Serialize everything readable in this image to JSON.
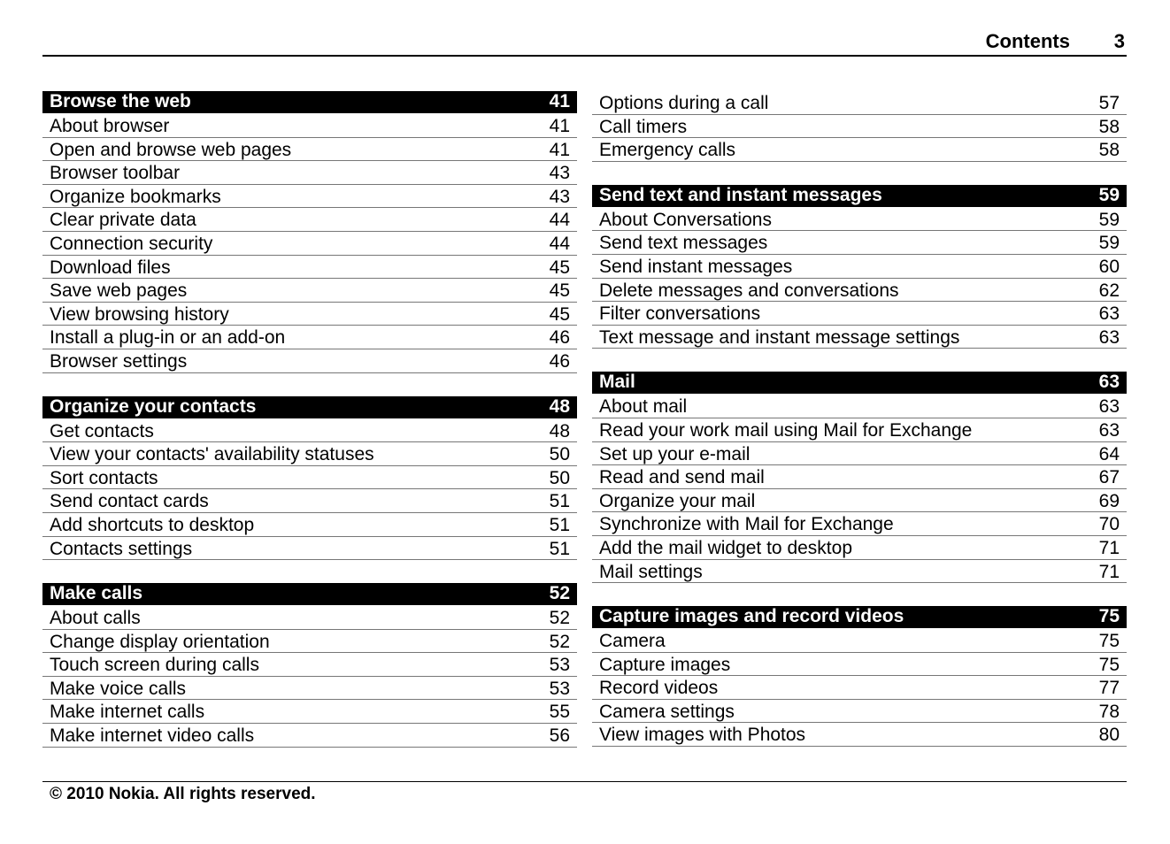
{
  "header": {
    "title": "Contents",
    "page_number": "3"
  },
  "left_column": [
    {
      "title": "Browse the web",
      "page": "41",
      "items": [
        {
          "label": "About browser",
          "page": "41"
        },
        {
          "label": "Open and browse web pages",
          "page": "41"
        },
        {
          "label": "Browser toolbar",
          "page": "43"
        },
        {
          "label": "Organize bookmarks",
          "page": "43"
        },
        {
          "label": "Clear private data",
          "page": "44"
        },
        {
          "label": "Connection security",
          "page": "44"
        },
        {
          "label": "Download files",
          "page": "45"
        },
        {
          "label": "Save web pages",
          "page": "45"
        },
        {
          "label": "View browsing history",
          "page": "45"
        },
        {
          "label": "Install a plug-in or an add-on",
          "page": "46"
        },
        {
          "label": "Browser settings",
          "page": "46"
        }
      ]
    },
    {
      "title": "Organize your contacts",
      "page": "48",
      "items": [
        {
          "label": "Get contacts",
          "page": "48"
        },
        {
          "label": "View your contacts' availability statuses",
          "page": "50"
        },
        {
          "label": "Sort contacts",
          "page": "50"
        },
        {
          "label": "Send contact cards",
          "page": "51"
        },
        {
          "label": "Add shortcuts to desktop",
          "page": "51"
        },
        {
          "label": "Contacts settings",
          "page": "51"
        }
      ]
    },
    {
      "title": "Make calls",
      "page": "52",
      "items": [
        {
          "label": "About calls",
          "page": "52"
        },
        {
          "label": "Change display orientation",
          "page": "52"
        },
        {
          "label": "Touch screen during calls",
          "page": "53"
        },
        {
          "label": "Make voice calls",
          "page": "53"
        },
        {
          "label": "Make internet calls",
          "page": "55"
        },
        {
          "label": "Make internet video calls",
          "page": "56"
        }
      ]
    }
  ],
  "right_column": [
    {
      "title": null,
      "page": null,
      "items": [
        {
          "label": "Options during a call",
          "page": "57"
        },
        {
          "label": "Call timers",
          "page": "58"
        },
        {
          "label": "Emergency calls",
          "page": "58"
        }
      ]
    },
    {
      "title": "Send text and instant messages",
      "page": "59",
      "items": [
        {
          "label": "About Conversations",
          "page": "59"
        },
        {
          "label": "Send text messages",
          "page": "59"
        },
        {
          "label": "Send instant messages",
          "page": "60"
        },
        {
          "label": "Delete messages and conversations",
          "page": "62"
        },
        {
          "label": "Filter conversations",
          "page": "63"
        },
        {
          "label": "Text message and instant message settings",
          "page": "63"
        }
      ]
    },
    {
      "title": "Mail",
      "page": "63",
      "items": [
        {
          "label": "About mail",
          "page": "63"
        },
        {
          "label": "Read your work mail using Mail for Exchange",
          "page": "63"
        },
        {
          "label": "Set up your e-mail",
          "page": "64"
        },
        {
          "label": "Read and send mail",
          "page": "67"
        },
        {
          "label": "Organize your mail",
          "page": "69"
        },
        {
          "label": "Synchronize with Mail for Exchange",
          "page": "70"
        },
        {
          "label": "Add the mail widget to desktop",
          "page": "71"
        },
        {
          "label": "Mail settings",
          "page": "71"
        }
      ]
    },
    {
      "title": "Capture images and record videos",
      "page": "75",
      "items": [
        {
          "label": "Camera",
          "page": "75"
        },
        {
          "label": "Capture images",
          "page": "75"
        },
        {
          "label": "Record videos",
          "page": "77"
        },
        {
          "label": "Camera settings",
          "page": "78"
        },
        {
          "label": "View images with Photos",
          "page": "80"
        }
      ]
    }
  ],
  "footer": {
    "copyright": "© 2010 Nokia. All rights reserved."
  }
}
